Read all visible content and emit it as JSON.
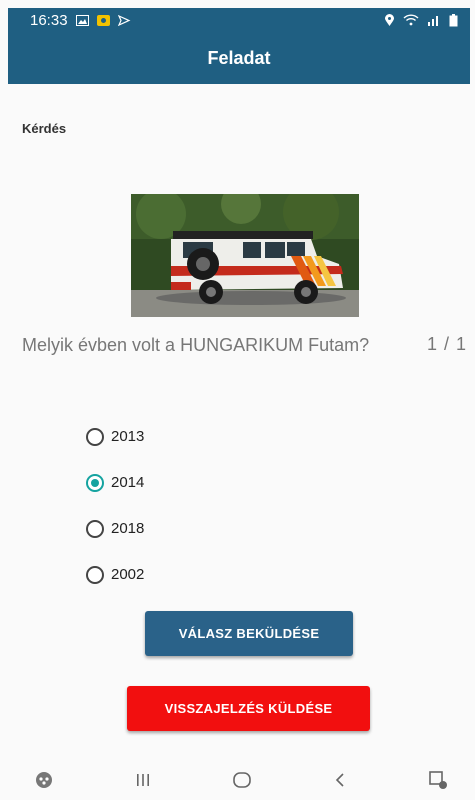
{
  "status_bar": {
    "time": "16:33"
  },
  "app_bar": {
    "title": "Feladat"
  },
  "question_section": {
    "label": "Kérdés",
    "question_text": "Melyik évben volt a HUNGARIKUM Futam?",
    "counter": "1 / 1"
  },
  "options": [
    {
      "label": "2013",
      "selected": false
    },
    {
      "label": "2014",
      "selected": true
    },
    {
      "label": "2018",
      "selected": false
    },
    {
      "label": "2002",
      "selected": false
    }
  ],
  "buttons": {
    "submit": "VÁLASZ BEKÜLDÉSE",
    "feedback": "VISSZAJELZÉS KÜLDÉSE"
  },
  "colors": {
    "app_bar": "#1f5f82",
    "submit_button": "#2a6289",
    "feedback_button": "#f20f0f",
    "radio_selected": "#15a3a0"
  },
  "icons": {
    "status_left": [
      "image-icon",
      "notification-icon",
      "cast-icon"
    ],
    "status_right": [
      "location-icon",
      "wifi-icon",
      "signal-icon",
      "battery-icon"
    ],
    "nav": [
      "game-icon",
      "recent-apps-icon",
      "home-icon",
      "back-icon",
      "screenshot-icon"
    ]
  }
}
